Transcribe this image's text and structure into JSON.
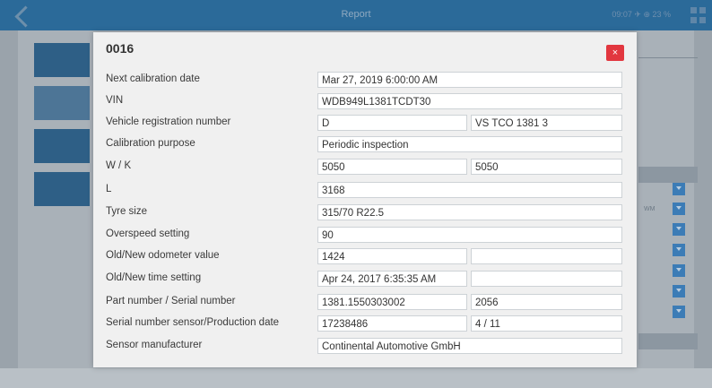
{
  "app": {
    "title": "Report",
    "status": "09:07  ✈  ⊕ 23 %"
  },
  "background": {
    "side_text": "WM"
  },
  "dialog": {
    "title": "0016",
    "close_label": "×",
    "rows": [
      {
        "label": "Next calibration date",
        "values": [
          "Mar 27, 2019 6:00:00 AM"
        ]
      },
      {
        "label": "VIN",
        "values": [
          "WDB949L1381TCDT30"
        ]
      },
      {
        "label": "Vehicle registration number",
        "values": [
          "D",
          "VS TCO 1381 3"
        ]
      },
      {
        "label": "Calibration purpose",
        "values": [
          "Periodic inspection"
        ]
      },
      {
        "label": "W / K",
        "values": [
          "5050",
          "5050"
        ]
      },
      {
        "label": "L",
        "values": [
          "3168"
        ]
      },
      {
        "label": "Tyre size",
        "values": [
          "315/70 R22.5"
        ]
      },
      {
        "label": "Overspeed setting",
        "values": [
          "90"
        ]
      },
      {
        "label": "Old/New odometer value",
        "values": [
          "1424",
          ""
        ]
      },
      {
        "label": "Old/New time setting",
        "values": [
          "Apr 24, 2017 6:35:35 AM",
          ""
        ]
      },
      {
        "label": "Part number / Serial number",
        "values": [
          "1381.1550303002",
          "2056"
        ]
      },
      {
        "label": "Serial number sensor/Production date",
        "values": [
          "17238486",
          "4 / 11"
        ]
      },
      {
        "label": "Sensor manufacturer",
        "values": [
          "Continental Automotive GmbH"
        ]
      }
    ]
  }
}
